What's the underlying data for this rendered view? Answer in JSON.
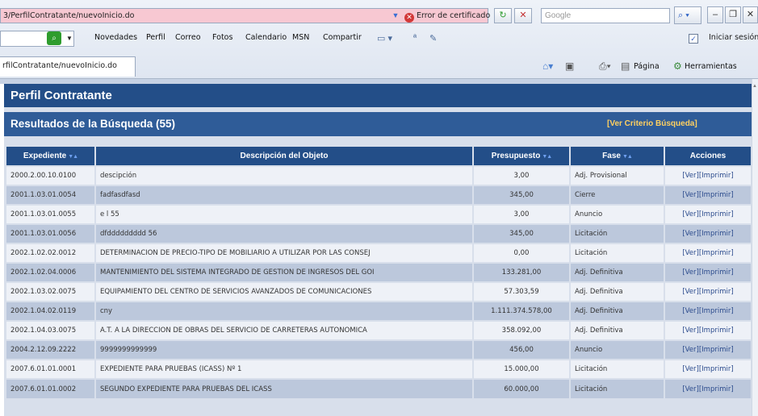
{
  "browser": {
    "address_url": "3/PerfilContratante/nuevoInicio.do",
    "cert_error": "Error de certificado",
    "search_placeholder": "Google",
    "toolbar_items": [
      "Novedades",
      "Perfil",
      "Correo",
      "Fotos",
      "Calendario",
      "MSN",
      "Compartir"
    ],
    "login_label": "Iniciar sesión",
    "tab_label": "rfilContratante/nuevoInicio.do",
    "page_menu": "Página",
    "tools_menu": "Herramientas"
  },
  "page": {
    "title": "Perfil Contratante",
    "results_title": "Resultados de la Búsqueda (55)",
    "criteria_link": "[Ver Criterio Búsqueda]"
  },
  "table": {
    "headers": [
      "Expediente",
      "Descripción del Objeto",
      "Presupuesto",
      "Fase",
      "Acciones"
    ],
    "rows": [
      {
        "expediente": "2000.2.00.10.0100",
        "descripcion": "descipción",
        "presupuesto": "3,00",
        "fase": "Adj. Provisional",
        "ver": "[Ver]",
        "imprimir": "[Imprimir]"
      },
      {
        "expediente": "2001.1.03.01.0054",
        "descripcion": "fadfasdfasd",
        "presupuesto": "345,00",
        "fase": "Cierre",
        "ver": "[Ver]",
        "imprimir": "[Imprimir]"
      },
      {
        "expediente": "2001.1.03.01.0055",
        "descripcion": "e l 55",
        "presupuesto": "3,00",
        "fase": "Anuncio",
        "ver": "[Ver]",
        "imprimir": "[Imprimir]"
      },
      {
        "expediente": "2001.1.03.01.0056",
        "descripcion": "dfddddddddd 56",
        "presupuesto": "345,00",
        "fase": "Licitación",
        "ver": "[Ver]",
        "imprimir": "[Imprimir]"
      },
      {
        "expediente": "2002.1.02.02.0012",
        "descripcion": "DETERMINACION DE PRECIO-TIPO DE MOBILIARIO A UTILIZAR POR LAS CONSEJ",
        "presupuesto": "0,00",
        "fase": "Licitación",
        "ver": "[Ver]",
        "imprimir": "[Imprimir]"
      },
      {
        "expediente": "2002.1.02.04.0006",
        "descripcion": "MANTENIMIENTO DEL SISTEMA INTEGRADO DE GESTION DE INGRESOS DEL GOI",
        "presupuesto": "133.281,00",
        "fase": "Adj. Definitiva",
        "ver": "[Ver]",
        "imprimir": "[Imprimir]"
      },
      {
        "expediente": "2002.1.03.02.0075",
        "descripcion": "EQUIPAMIENTO DEL CENTRO DE SERVICIOS AVANZADOS DE COMUNICACIONES",
        "presupuesto": "57.303,59",
        "fase": "Adj. Definitiva",
        "ver": "[Ver]",
        "imprimir": "[Imprimir]"
      },
      {
        "expediente": "2002.1.04.02.0119",
        "descripcion": "cny",
        "presupuesto": "1.111.374.578,00",
        "fase": "Adj. Definitiva",
        "ver": "[Ver]",
        "imprimir": "[Imprimir]"
      },
      {
        "expediente": "2002.1.04.03.0075",
        "descripcion": "A.T. A LA DIRECCION DE OBRAS DEL SERVICIO DE CARRETERAS AUTONOMICA",
        "presupuesto": "358.092,00",
        "fase": "Adj. Definitiva",
        "ver": "[Ver]",
        "imprimir": "[Imprimir]"
      },
      {
        "expediente": "2004.2.12.09.2222",
        "descripcion": "9999999999999",
        "presupuesto": "456,00",
        "fase": "Anuncio",
        "ver": "[Ver]",
        "imprimir": "[Imprimir]"
      },
      {
        "expediente": "2007.6.01.01.0001",
        "descripcion": "EXPEDIENTE PARA PRUEBAS (ICASS) Nº 1",
        "presupuesto": "15.000,00",
        "fase": "Licitación",
        "ver": "[Ver]",
        "imprimir": "[Imprimir]"
      },
      {
        "expediente": "2007.6.01.01.0002",
        "descripcion": "SEGUNDO EXPEDIENTE PARA PRUEBAS DEL ICASS",
        "presupuesto": "60.000,00",
        "fase": "Licitación",
        "ver": "[Ver]",
        "imprimir": "[Imprimir]"
      }
    ]
  }
}
